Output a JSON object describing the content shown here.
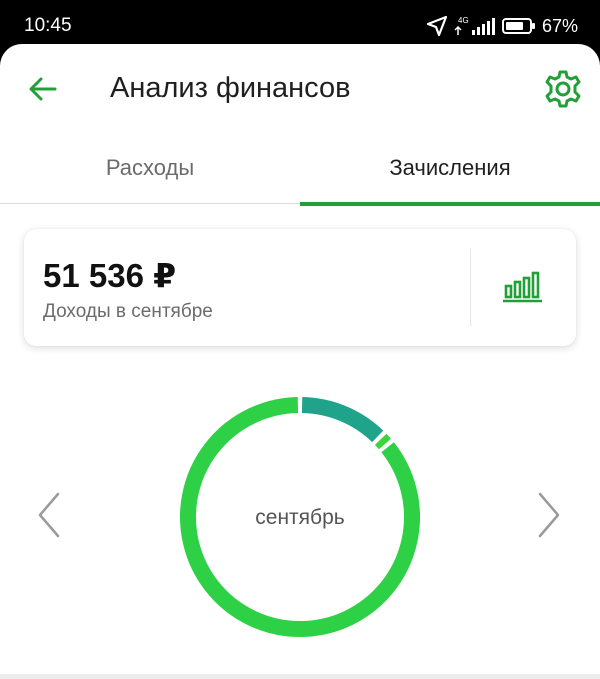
{
  "status_bar": {
    "time": "10:45",
    "network": "4G",
    "battery": "67%"
  },
  "header": {
    "title": "Анализ финансов",
    "back_icon": "arrow-left-icon",
    "settings_icon": "gear-icon"
  },
  "tabs": [
    {
      "label": "Расходы",
      "active": false
    },
    {
      "label": "Зачисления",
      "active": true
    }
  ],
  "summary": {
    "amount": "51 536 ₽",
    "caption": "Доходы в сентябре",
    "chart_icon": "bar-chart-icon"
  },
  "donut": {
    "center_label": "сентябрь",
    "prev_icon": "chevron-left-icon",
    "next_icon": "chevron-right-icon",
    "segments": [
      {
        "fraction": 0.125,
        "color": "#1fa38a"
      },
      {
        "fraction": 0.015,
        "color": "#3ad53a"
      },
      {
        "fraction": 0.86,
        "color": "#2ed145"
      }
    ]
  },
  "colors": {
    "accent": "#21a038"
  }
}
